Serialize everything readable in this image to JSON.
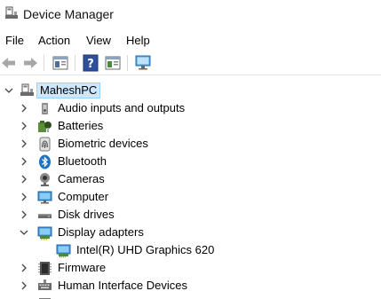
{
  "window": {
    "title": "Device Manager",
    "icon": "device-manager-icon"
  },
  "menu": {
    "file": "File",
    "action": "Action",
    "view": "View",
    "help": "Help"
  },
  "toolbar": {
    "buttons": [
      "back-arrow-icon",
      "forward-arrow-icon",
      "properties-icon",
      "help-icon",
      "update-driver-icon",
      "scan-hardware-icon"
    ]
  },
  "tree": {
    "root": {
      "label": "MaheshPC",
      "icon": "computer-root-icon",
      "expanded": true,
      "selected": true
    },
    "items": [
      {
        "label": "Audio inputs and outputs",
        "icon": "speaker-icon",
        "expanded": false
      },
      {
        "label": "Batteries",
        "icon": "battery-icon",
        "expanded": false
      },
      {
        "label": "Biometric devices",
        "icon": "fingerprint-icon",
        "expanded": false
      },
      {
        "label": "Bluetooth",
        "icon": "bluetooth-icon",
        "expanded": false
      },
      {
        "label": "Cameras",
        "icon": "camera-icon",
        "expanded": false
      },
      {
        "label": "Computer",
        "icon": "monitor-icon",
        "expanded": false
      },
      {
        "label": "Disk drives",
        "icon": "disk-drive-icon",
        "expanded": false
      },
      {
        "label": "Display adapters",
        "icon": "display-adapter-icon",
        "expanded": true,
        "children": [
          {
            "label": "Intel(R) UHD Graphics 620",
            "icon": "display-adapter-icon"
          }
        ]
      },
      {
        "label": "Firmware",
        "icon": "firmware-chip-icon",
        "expanded": false
      },
      {
        "label": "Human Interface Devices",
        "icon": "hid-keyboard-icon",
        "expanded": false
      }
    ]
  },
  "colors": {
    "selection_bg": "#cce8ff",
    "selection_border": "#99d1ff",
    "accent_blue": "#1a73c8"
  }
}
